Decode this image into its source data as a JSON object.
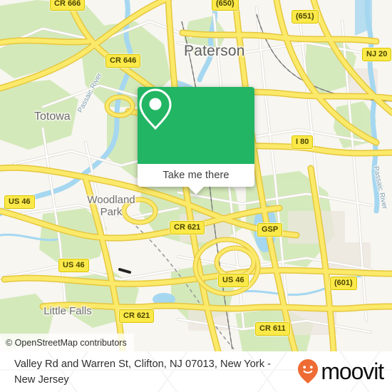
{
  "map": {
    "attribution": "© OpenStreetMap contributors",
    "colors": {
      "background": "#f7f6f1",
      "road_major": "#f7de5a",
      "road_minor": "#ffffff",
      "park": "#cfe8b5",
      "water": "#9fd4ef",
      "shield_fill": "#fbe94a",
      "callout_green": "#22b563",
      "brand_orange": "#ee6b33"
    },
    "city_labels": [
      {
        "name": "Paterson",
        "size": "large"
      },
      {
        "name": "Totowa",
        "size": "medium"
      },
      {
        "name": "Woodland Park",
        "size": "small"
      },
      {
        "name": "Little Falls",
        "size": "small"
      }
    ],
    "water_labels": [
      {
        "name": "Passaic River"
      },
      {
        "name": "Passaic River"
      }
    ],
    "road_shields": [
      {
        "label": "CR 666"
      },
      {
        "label": "(650)"
      },
      {
        "label": "(651)"
      },
      {
        "label": "CR 646"
      },
      {
        "label": "NJ 20"
      },
      {
        "label": "I 80"
      },
      {
        "label": "US 46"
      },
      {
        "label": "CR 621"
      },
      {
        "label": "GSP"
      },
      {
        "label": "US 46"
      },
      {
        "label": "US 46"
      },
      {
        "label": "(601)"
      },
      {
        "label": "CR 621"
      },
      {
        "label": "CR 611"
      }
    ]
  },
  "callout": {
    "icon": "map-pin-icon",
    "button_label": "Take me there"
  },
  "footer": {
    "address": "Valley Rd and Warren St, Clifton, NJ 07013, New York - New Jersey",
    "brand_name": "moovit",
    "brand_icon": "moovit-smiley-pin-icon"
  }
}
